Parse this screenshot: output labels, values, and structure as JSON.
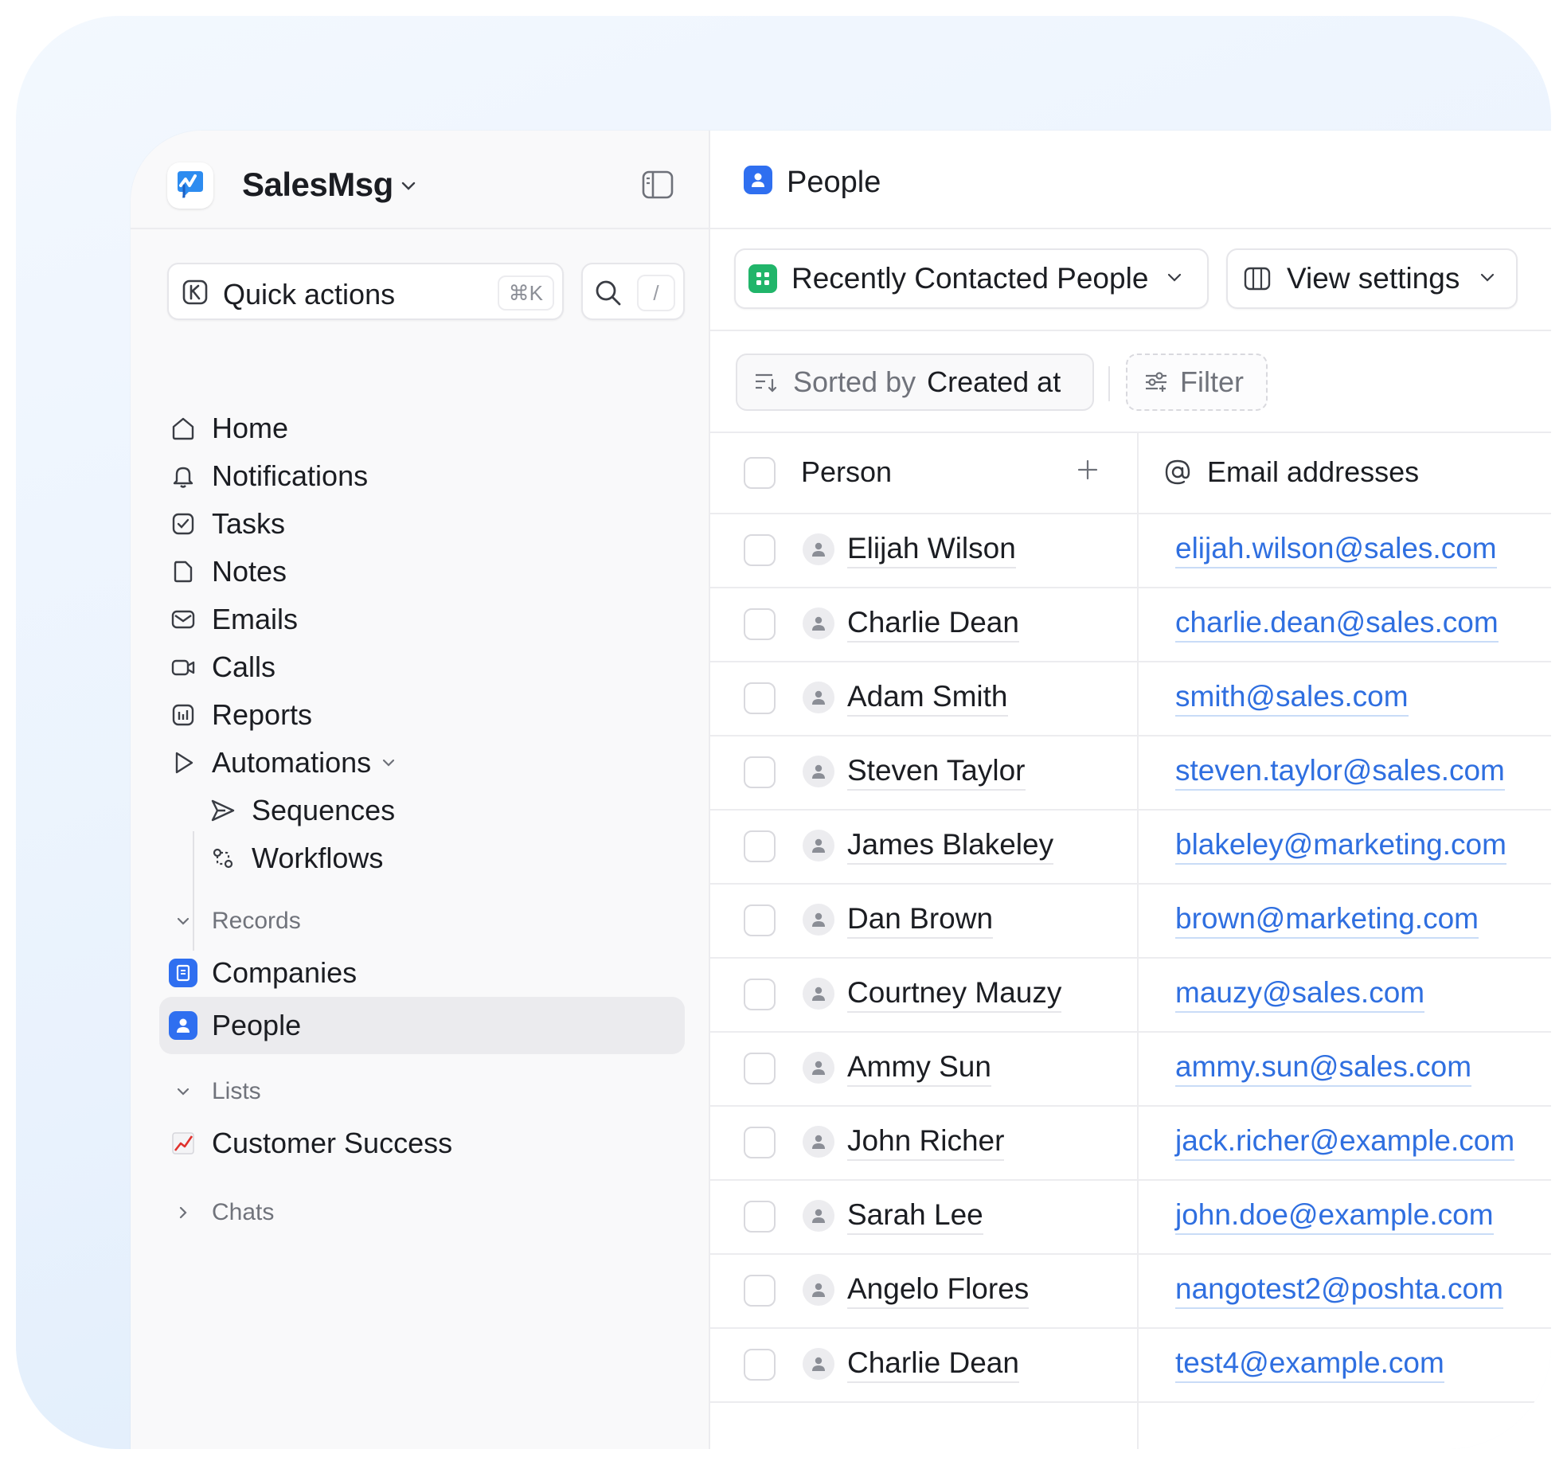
{
  "workspace": {
    "name": "SalesMsg"
  },
  "sidebar": {
    "quick_actions": {
      "label": "Quick actions",
      "shortcut": "⌘K"
    },
    "search": {
      "shortcut": "/"
    },
    "nav": [
      {
        "label": "Home",
        "icon": "home-icon"
      },
      {
        "label": "Notifications",
        "icon": "bell-icon"
      },
      {
        "label": "Tasks",
        "icon": "checkbox-icon"
      },
      {
        "label": "Notes",
        "icon": "note-icon"
      },
      {
        "label": "Emails",
        "icon": "mail-icon"
      },
      {
        "label": "Calls",
        "icon": "video-icon"
      },
      {
        "label": "Reports",
        "icon": "chart-icon"
      },
      {
        "label": "Automations",
        "icon": "play-icon"
      }
    ],
    "automations_sub": [
      {
        "label": "Sequences",
        "icon": "send-icon"
      },
      {
        "label": "Workflows",
        "icon": "workflow-icon"
      }
    ],
    "records": {
      "label": "Records",
      "items": [
        {
          "label": "Companies",
          "icon": "building-icon"
        },
        {
          "label": "People",
          "icon": "person-icon",
          "active": true
        }
      ]
    },
    "lists": {
      "label": "Lists",
      "items": [
        {
          "label": "Customer Success",
          "icon": "chart-increasing-emoji"
        }
      ]
    },
    "chats": {
      "label": "Chats"
    }
  },
  "main": {
    "title": "People",
    "view": {
      "label": "Recently Contacted People"
    },
    "view_settings": {
      "label": "View settings"
    },
    "sort": {
      "prefix": "Sorted by",
      "value": "Created at"
    },
    "filter": {
      "label": "Filter"
    },
    "table": {
      "columns": [
        "Person",
        "Email addresses"
      ],
      "rows": [
        {
          "name": "Elijah Wilson",
          "email": "elijah.wilson@sales.com"
        },
        {
          "name": "Charlie Dean",
          "email": "charlie.dean@sales.com"
        },
        {
          "name": "Adam Smith",
          "email": "smith@sales.com"
        },
        {
          "name": "Steven Taylor",
          "email": "steven.taylor@sales.com"
        },
        {
          "name": "James Blakeley",
          "email": "blakeley@marketing.com"
        },
        {
          "name": "Dan Brown",
          "email": "brown@marketing.com"
        },
        {
          "name": "Courtney Mauzy",
          "email": "mauzy@sales.com"
        },
        {
          "name": "Ammy Sun",
          "email": "ammy.sun@sales.com"
        },
        {
          "name": "John Richer",
          "email": "jack.richer@example.com"
        },
        {
          "name": "Sarah Lee",
          "email": "john.doe@example.com"
        },
        {
          "name": "Angelo Flores",
          "email": "nangotest2@poshta.com"
        },
        {
          "name": "Charlie Dean",
          "email": "test4@example.com"
        }
      ]
    }
  },
  "colors": {
    "accent_blue": "#2f6ff0",
    "link": "#2f6fe0",
    "view_green": "#21b56a"
  }
}
